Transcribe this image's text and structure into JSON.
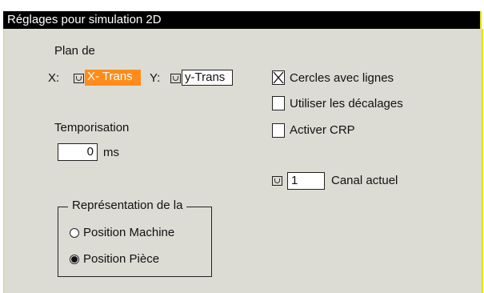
{
  "window": {
    "title": "Réglages pour simulation 2D"
  },
  "plan": {
    "label": "Plan de",
    "x_label": "X:",
    "x_value": "X- Trans",
    "y_label": "Y:",
    "y_value": "y-Trans"
  },
  "timing": {
    "label": "Temporisation",
    "value": "0",
    "unit": "ms"
  },
  "options": {
    "circles_label": "Cercles avec lignes",
    "circles_checked": true,
    "offsets_label": "Utiliser les décalages",
    "offsets_checked": false,
    "crp_label": "Activer CRP",
    "crp_checked": false
  },
  "channel": {
    "value": "1",
    "label": "Canal actuel"
  },
  "representation": {
    "legend": "Représentation de la",
    "machine_label": "Position Machine",
    "machine_selected": false,
    "piece_label": "Position Pièce",
    "piece_selected": true
  },
  "colors": {
    "title_bg": "#000000",
    "panel_bg": "#dcdcd4",
    "accent": "#ff8c1a",
    "border_accent": "#e8e000"
  }
}
